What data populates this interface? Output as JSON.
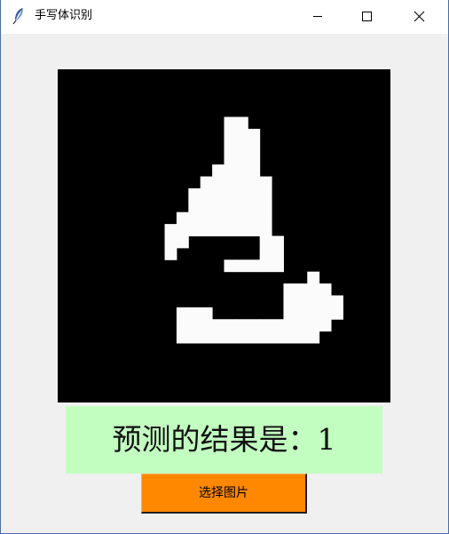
{
  "window": {
    "title": "手写体识别",
    "icon": "feather-icon",
    "controls": [
      "minimize-icon",
      "maximize-icon",
      "close-icon"
    ]
  },
  "image": {
    "description_icon": "handwritten-digit-image",
    "grid_size": 28,
    "rows": [
      "............................",
      "............................",
      "............................",
      "............................",
      "..............##............",
      "..............###...........",
      "..............###...........",
      "..............###...........",
      ".............####...........",
      "............######..........",
      "...........#######..........",
      "...........#######..........",
      "..........########..........",
      ".........#########..........",
      ".........##......##.........",
      ".........#.......##.........",
      "..............#####.........",
      ".....................#......",
      "...................####.....",
      "...................#####....",
      "..........###......#####....",
      "..........#############.....",
      "..........############......",
      "............................",
      "............................",
      "............................",
      "............................",
      "............................"
    ]
  },
  "result": {
    "text": "预测的结果是：1"
  },
  "button": {
    "label": "选择图片"
  },
  "colors": {
    "result_bg": "#c3fec1",
    "button_bg": "#ff8800",
    "client_bg": "#f0f0f0"
  }
}
